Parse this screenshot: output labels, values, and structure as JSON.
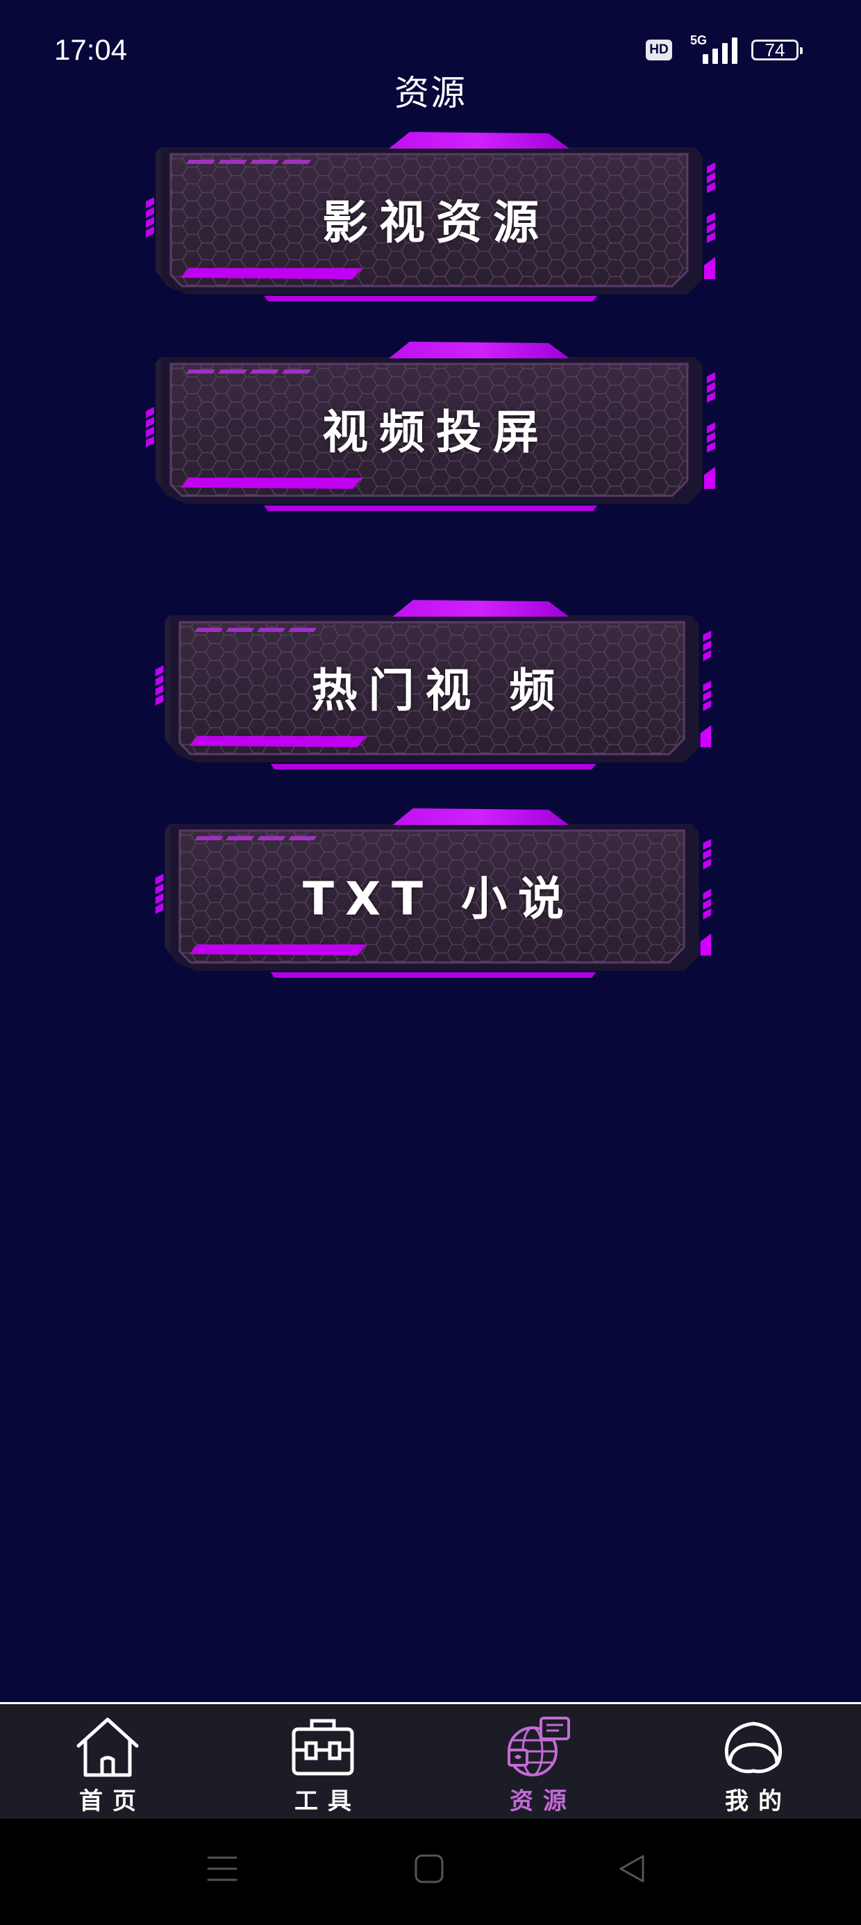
{
  "status_bar": {
    "time": "17:04",
    "hd": "HD",
    "network": "5G",
    "battery": "74"
  },
  "page": {
    "title": "资源"
  },
  "buttons": [
    {
      "label": "影视资源"
    },
    {
      "label": "视频投屏"
    },
    {
      "label": "热门视 频"
    },
    {
      "label": "TXT 小说"
    }
  ],
  "bottom_nav": {
    "items": [
      {
        "label": "首页",
        "icon": "home-icon",
        "active": false
      },
      {
        "label": "工具",
        "icon": "toolbox-icon",
        "active": false
      },
      {
        "label": "资源",
        "icon": "globe-chat-icon",
        "active": true
      },
      {
        "label": "我的",
        "icon": "profile-icon",
        "active": false
      }
    ]
  },
  "colors": {
    "background": "#070739",
    "accent": "#c000f0",
    "active_nav": "#c36bd6",
    "nav_bg": "#1c1c26"
  },
  "system_nav": {
    "icons": [
      "menu-icon",
      "home-square-icon",
      "back-triangle-icon"
    ]
  }
}
